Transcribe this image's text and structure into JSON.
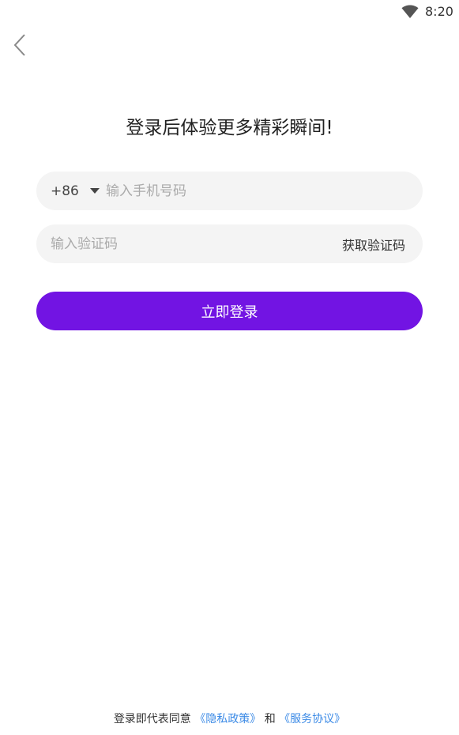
{
  "status_bar": {
    "time": "8:20",
    "wifi_icon": "wifi-icon"
  },
  "nav": {
    "back_icon": "chevron-left-icon"
  },
  "title": "登录后体验更多精彩瞬间!",
  "phone": {
    "country_code": "+86",
    "caret_icon": "caret-down-icon",
    "placeholder": "输入手机号码",
    "value": ""
  },
  "code": {
    "placeholder": "输入验证码",
    "value": "",
    "get_code_label": "获取验证码"
  },
  "login_label": "立即登录",
  "agreement": {
    "prefix": "登录即代表同意",
    "privacy_link": "《隐私政策》",
    "connector": "和",
    "terms_link": "《服务协议》"
  },
  "colors": {
    "accent": "#7214e3",
    "link": "#3b8ae6",
    "field_background": "#f4f4f4"
  }
}
